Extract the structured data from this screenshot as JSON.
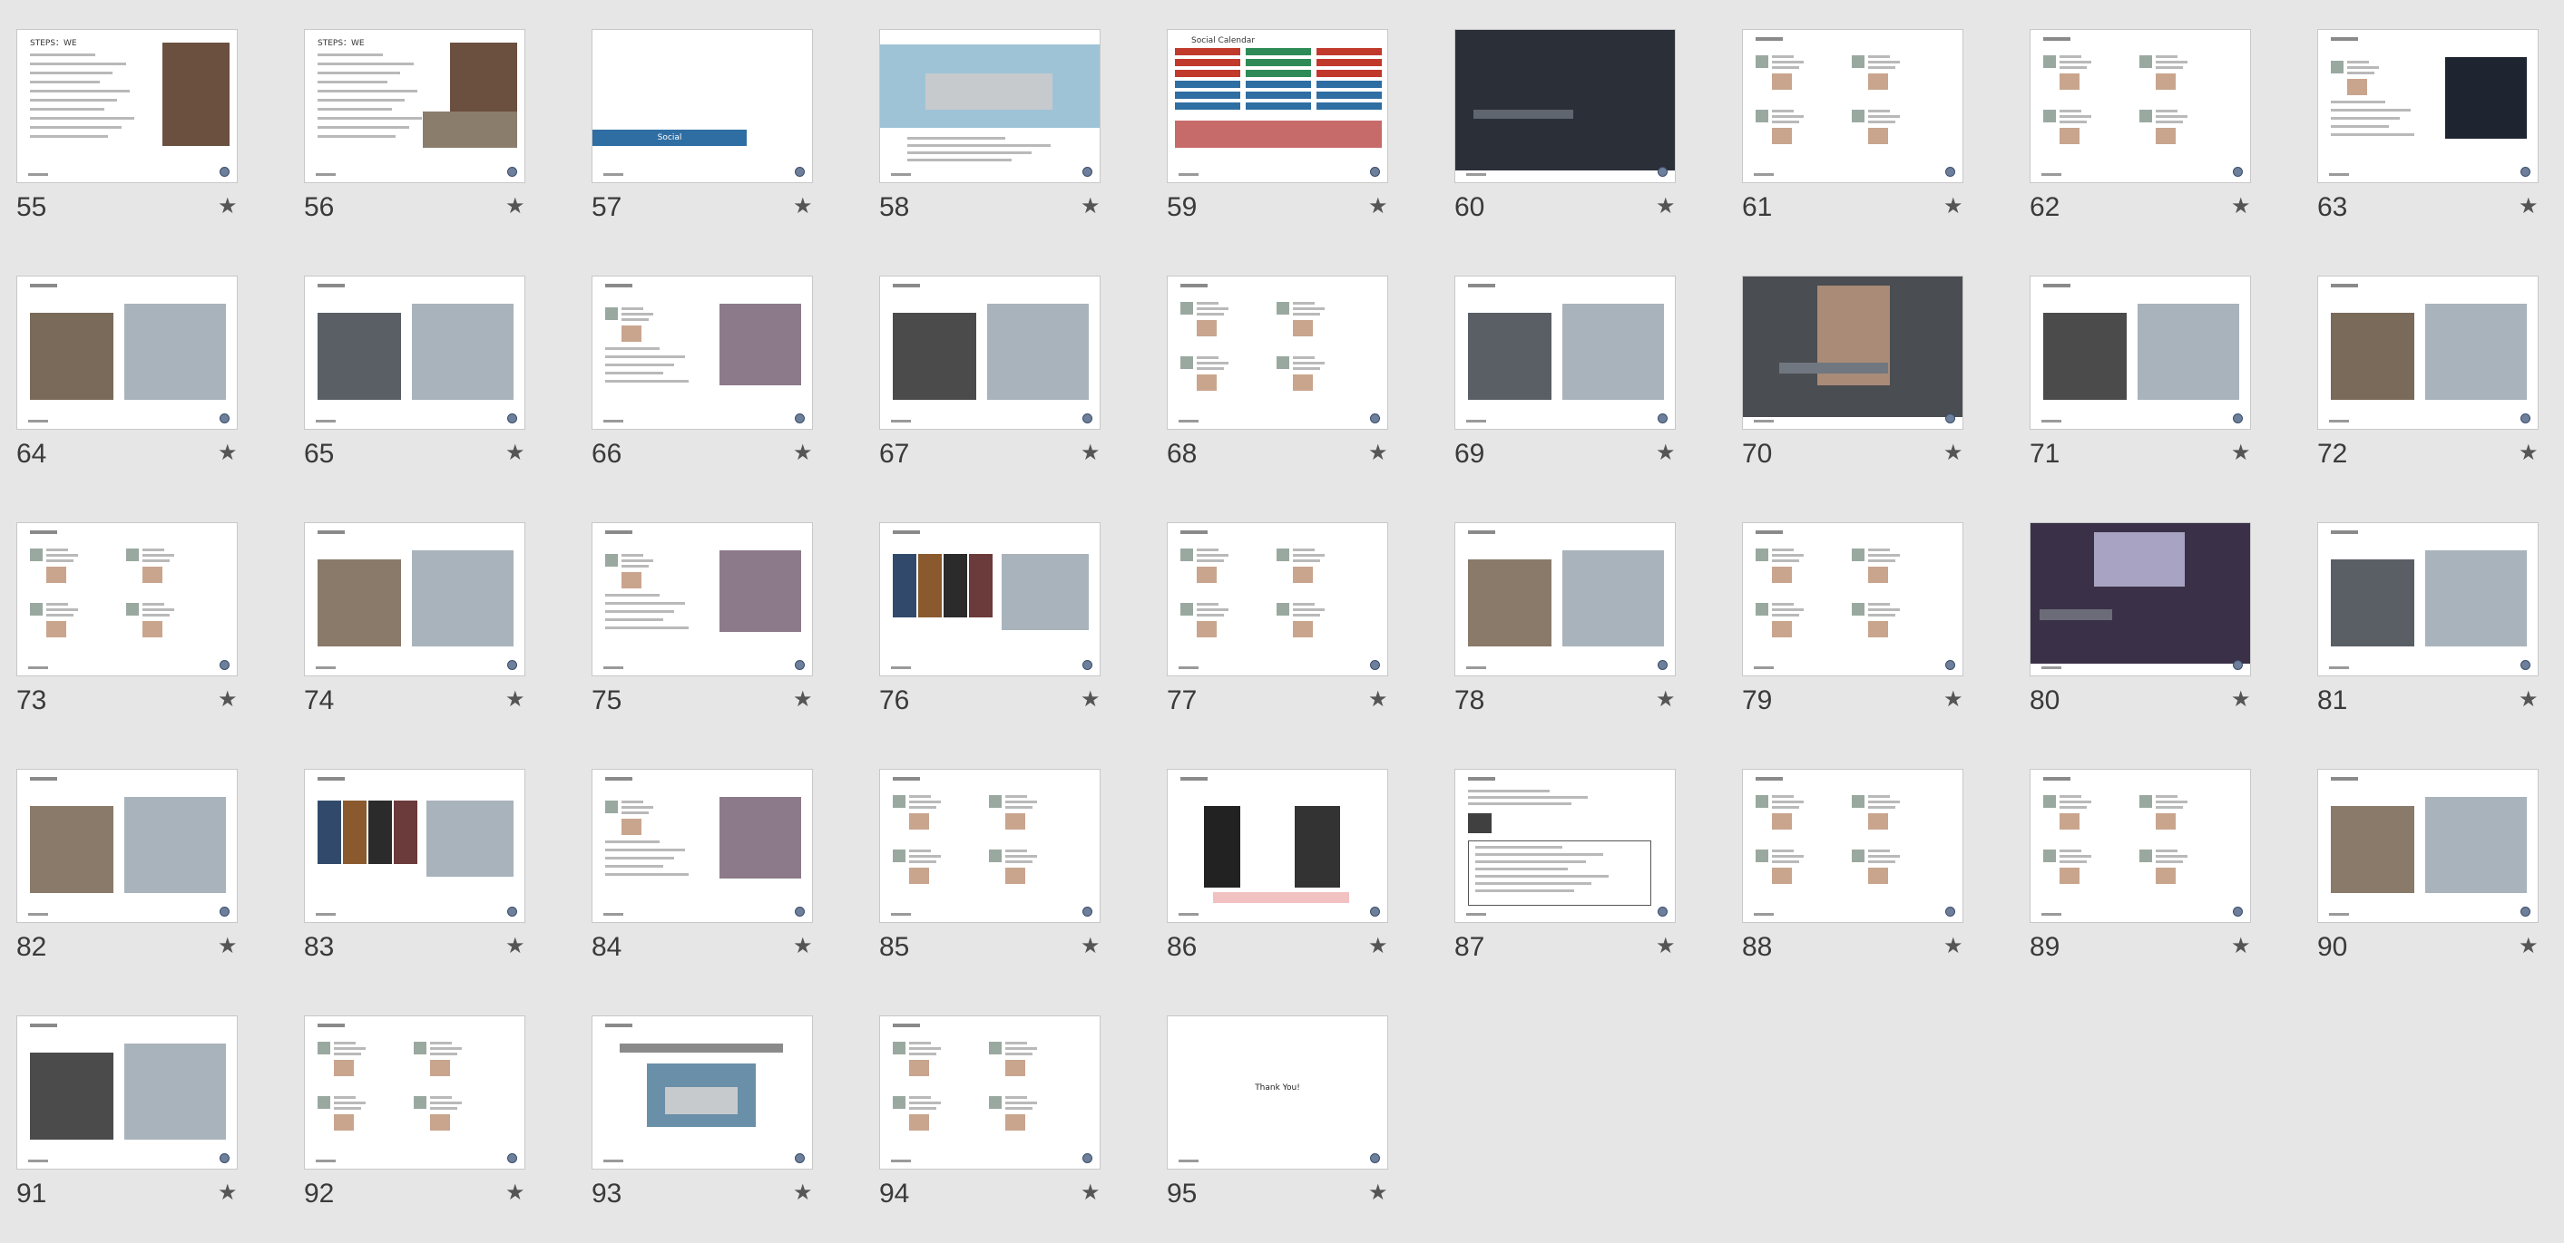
{
  "colors": {
    "background": "#e6e6e6",
    "thumb_border": "#c8c8c8",
    "blue_bar": "#2f6ea3",
    "gray_box": "#a9b3bb"
  },
  "icons": {
    "star": "star-icon",
    "logo": "vw-logo-icon"
  },
  "slides": [
    {
      "number": "55",
      "star": "★",
      "title": "STEPS：WE",
      "layout": "text-right-photo"
    },
    {
      "number": "56",
      "star": "★",
      "title": "STEPS：WE",
      "layout": "text-right-photos"
    },
    {
      "number": "57",
      "star": "★",
      "title": "",
      "layout": "blue-bar",
      "bar_text": "Social"
    },
    {
      "number": "58",
      "star": "★",
      "title": "",
      "layout": "car-banner"
    },
    {
      "number": "59",
      "star": "★",
      "title": "Social Calendar",
      "layout": "calendar"
    },
    {
      "number": "60",
      "star": "★",
      "title": "",
      "layout": "crowd"
    },
    {
      "number": "61",
      "star": "★",
      "title": "",
      "layout": "social-posts"
    },
    {
      "number": "62",
      "star": "★",
      "title": "",
      "layout": "social-posts"
    },
    {
      "number": "63",
      "star": "★",
      "title": "",
      "layout": "post-dark-image"
    },
    {
      "number": "64",
      "star": "★",
      "title": "",
      "layout": "person-graybox"
    },
    {
      "number": "65",
      "star": "★",
      "title": "",
      "layout": "social-posts-graybox"
    },
    {
      "number": "66",
      "star": "★",
      "title": "",
      "layout": "post-group-photo"
    },
    {
      "number": "67",
      "star": "★",
      "title": "",
      "layout": "calligraphy-graybox"
    },
    {
      "number": "68",
      "star": "★",
      "title": "",
      "layout": "social-posts"
    },
    {
      "number": "69",
      "star": "★",
      "title": "",
      "layout": "graybox-posts"
    },
    {
      "number": "70",
      "star": "★",
      "title": "",
      "layout": "portrait-full"
    },
    {
      "number": "71",
      "star": "★",
      "title": "",
      "layout": "faces-graybox"
    },
    {
      "number": "72",
      "star": "★",
      "title": "",
      "layout": "photo-graybox"
    },
    {
      "number": "73",
      "star": "★",
      "title": "",
      "layout": "social-posts"
    },
    {
      "number": "74",
      "star": "★",
      "title": "",
      "layout": "calligraphy-text"
    },
    {
      "number": "75",
      "star": "★",
      "title": "",
      "layout": "post-photo-right"
    },
    {
      "number": "76",
      "star": "★",
      "title": "",
      "layout": "posters-graybox"
    },
    {
      "number": "77",
      "star": "★",
      "title": "",
      "layout": "social-posts"
    },
    {
      "number": "78",
      "star": "★",
      "title": "",
      "layout": "photo-graybox"
    },
    {
      "number": "79",
      "star": "★",
      "title": "",
      "layout": "social-posts"
    },
    {
      "number": "80",
      "star": "★",
      "title": "",
      "layout": "concert"
    },
    {
      "number": "81",
      "star": "★",
      "title": "",
      "layout": "portrait-graybox"
    },
    {
      "number": "82",
      "star": "★",
      "title": "",
      "layout": "dots-graybox"
    },
    {
      "number": "83",
      "star": "★",
      "title": "",
      "layout": "posters-row"
    },
    {
      "number": "84",
      "star": "★",
      "title": "",
      "layout": "post-portrait-right"
    },
    {
      "number": "85",
      "star": "★",
      "title": "",
      "layout": "social-posts"
    },
    {
      "number": "86",
      "star": "★",
      "title": "",
      "layout": "two-persons"
    },
    {
      "number": "87",
      "star": "★",
      "title": "",
      "layout": "boxed-list"
    },
    {
      "number": "88",
      "star": "★",
      "title": "",
      "layout": "social-posts"
    },
    {
      "number": "89",
      "star": "★",
      "title": "",
      "layout": "social-posts"
    },
    {
      "number": "90",
      "star": "★",
      "title": "",
      "layout": "graybox-posts"
    },
    {
      "number": "91",
      "star": "★",
      "title": "",
      "layout": "graybox-posts"
    },
    {
      "number": "92",
      "star": "★",
      "title": "",
      "layout": "social-posts"
    },
    {
      "number": "93",
      "star": "★",
      "title": "",
      "layout": "car-center"
    },
    {
      "number": "94",
      "star": "★",
      "title": "",
      "layout": "social-posts"
    },
    {
      "number": "95",
      "star": "★",
      "title": "",
      "layout": "thank-you",
      "center_text": "Thank You!"
    }
  ]
}
